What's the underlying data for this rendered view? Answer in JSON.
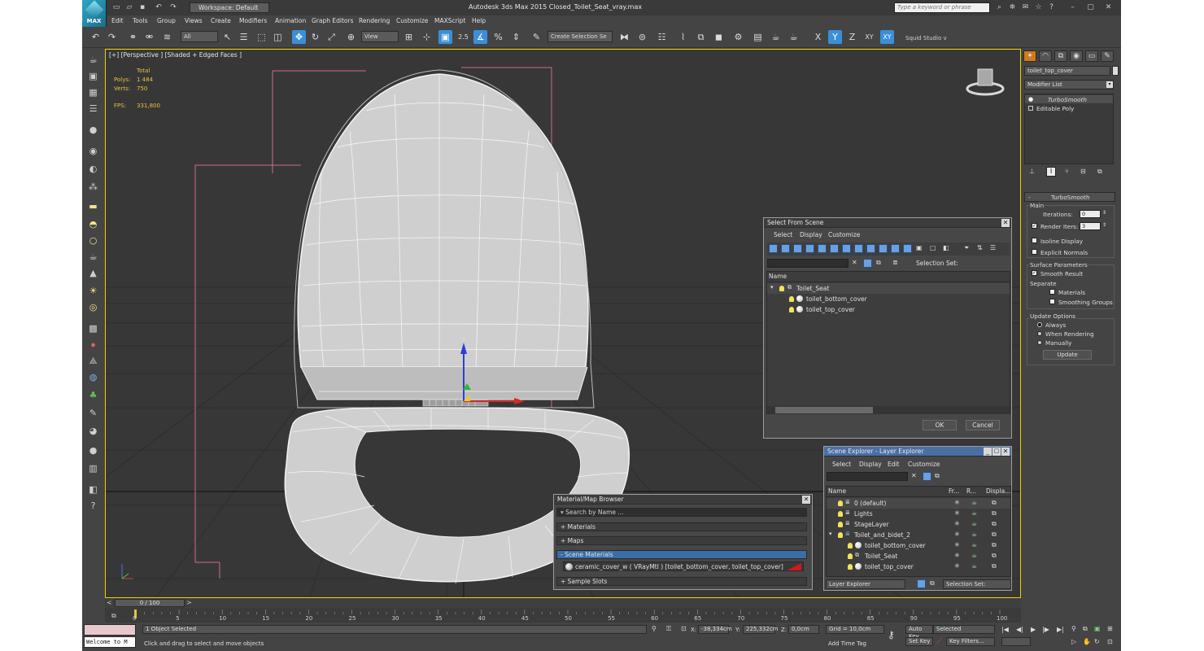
{
  "app": {
    "logo_text": "MAX",
    "workspace": "Workspace: Default",
    "window_title": "Autodesk 3ds Max  2015     Closed_Toilet_Seat_vray.max",
    "search_placeholder": "Type a keyword or phrase"
  },
  "menu": [
    "Edit",
    "Tools",
    "Group",
    "Views",
    "Create",
    "Modifiers",
    "Animation",
    "Graph Editors",
    "Rendering",
    "Customize",
    "MAXScript",
    "Help"
  ],
  "toolbar": {
    "selection_filter": "All",
    "ref_coord": "View",
    "snap_label": "2.5",
    "named_selection": "Create Selection Se",
    "axis_x": "X",
    "axis_y": "Y",
    "axis_z": "Z",
    "axis_xy": "XY",
    "axis_xy2": "XY",
    "studio": "Squid Studio v"
  },
  "viewport": {
    "label": "[+] [Perspective ] [Shaded + Edged Faces ]",
    "stats": {
      "total_label": "Total",
      "polys_label": "Polys:",
      "polys_value": "1 484",
      "verts_label": "Verts:",
      "verts_value": "750",
      "fps_label": "FPS:",
      "fps_value": "331,800"
    },
    "gizmo_z": "z"
  },
  "select_from_scene": {
    "title": "Select From Scene",
    "menus": [
      "Select",
      "Display",
      "Customize"
    ],
    "selection_set_label": "Selection Set:",
    "column_name": "Name",
    "tree": [
      {
        "name": "Toilet_Seat",
        "level": 0
      },
      {
        "name": "toilet_bottom_cover",
        "level": 1
      },
      {
        "name": "toilet_top_cover",
        "level": 1
      }
    ],
    "ok": "OK",
    "cancel": "Cancel"
  },
  "scene_explorer": {
    "title": "Scene Explorer - Layer Explorer",
    "menus": [
      "Select",
      "Display",
      "Edit",
      "Customize"
    ],
    "columns": [
      "Name",
      "Fr...",
      "R...",
      "Displa..."
    ],
    "rows": [
      {
        "name": "0 (default)",
        "level": 0
      },
      {
        "name": "Lights",
        "level": 0
      },
      {
        "name": "StageLayer",
        "level": 0
      },
      {
        "name": "Toilet_and_bidet_2",
        "level": 0
      },
      {
        "name": "toilet_bottom_cover",
        "level": 1
      },
      {
        "name": "Toilet_Seat",
        "level": 1
      },
      {
        "name": "toilet_top_cover",
        "level": 1
      }
    ],
    "footer_dropdown": "Layer Explorer",
    "footer_selection_set": "Selection Set:"
  },
  "material_browser": {
    "title": "Material/Map Browser",
    "search_placeholder": "Search by Name ...",
    "sections": {
      "materials": "+ Materials",
      "maps": "+ Maps",
      "scene_materials": "- Scene Materials",
      "sample_slots": "+ Sample Slots"
    },
    "scene_material_item": "ceramic_cover_w  ( VRayMtl ) [toilet_bottom_cover, toilet_top_cover]"
  },
  "command_panel": {
    "object_name": "toilet_top_cover",
    "modifier_list": "Modifier List",
    "stack": [
      "TurboSmooth",
      "Editable Poly"
    ],
    "rollout_title": "TurboSmooth",
    "main_label": "Main",
    "iterations_label": "Iterations:",
    "iterations_value": "0",
    "render_iters_label": "Render Iters:",
    "render_iters_value": "3",
    "isoline_label": "Isoline Display",
    "explicit_normals_label": "Explicit Normals",
    "surface_params_label": "Surface Parameters",
    "smooth_result_label": "Smooth Result",
    "separate_label": "Separate",
    "materials_label": "Materials",
    "smoothing_groups_label": "Smoothing Groups",
    "update_options_label": "Update Options",
    "always_label": "Always",
    "when_rendering_label": "When Rendering",
    "manually_label": "Manually",
    "update_button": "Update"
  },
  "timeline": {
    "frame_counter": "0 / 100",
    "ticks": [
      "0",
      "5",
      "10",
      "15",
      "20",
      "25",
      "30",
      "35",
      "40",
      "45",
      "50",
      "55",
      "60",
      "65",
      "70",
      "75",
      "80",
      "85",
      "90",
      "95",
      "100"
    ]
  },
  "status": {
    "objects_selected": "1 Object Selected",
    "prompt": "Click and drag to select and move objects",
    "maxscript_listener": "Welcome to M",
    "x_label": "X:",
    "x_value": "-38,334cm",
    "y_label": "Y:",
    "y_value": "225,332cm",
    "z_label": "Z:",
    "z_value": "0,0cm",
    "grid": "Grid = 10,0cm",
    "add_time_tag": "Add Time Tag",
    "auto_key": "Auto Key",
    "set_key": "Set Key",
    "selected_dropdown": "Selected",
    "key_filters": "Key Filters..."
  }
}
